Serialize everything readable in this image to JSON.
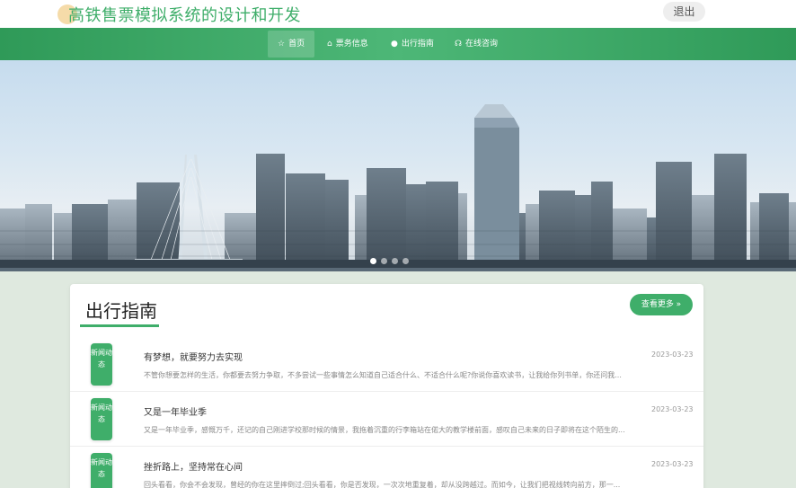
{
  "header": {
    "site_title": "高铁售票模拟系统的设计和开发",
    "logout_label": "退出"
  },
  "nav": {
    "items": [
      {
        "label": "首页",
        "icon": "star-icon",
        "glyph": "☆"
      },
      {
        "label": "票务信息",
        "icon": "bag-icon",
        "glyph": "⌂"
      },
      {
        "label": "出行指南",
        "icon": "circle-icon",
        "glyph": "●"
      },
      {
        "label": "在线咨询",
        "icon": "headset-icon",
        "glyph": "☊"
      }
    ],
    "active": "首页"
  },
  "banner": {
    "slide_count": 4,
    "active_slide": 1
  },
  "guide": {
    "title": "出行指南",
    "more_label": "查看更多 »",
    "items": [
      {
        "badge": "新闻动态",
        "title": "有梦想，就要努力去实现",
        "date": "2023-03-23",
        "summary": "不管你想要怎样的生活，你都要去努力争取，不多尝试一些事情怎么知道自己适合什么、不适合什么呢?你说你喜欢读书，让我给你列书单，你还问我..."
      },
      {
        "badge": "新闻动态",
        "title": "又是一年毕业季",
        "date": "2023-03-23",
        "summary": "又是一年毕业季，感慨万千，还记的自己刚进学校那时候的情景，我拖着沉重的行李箱站在偌大的教学楼前面，感叹自己未来的日子即将在这个陌生的..."
      },
      {
        "badge": "新闻动态",
        "title": "挫折路上，坚持常在心间",
        "date": "2023-03-23",
        "summary": "回头看看，你会不会发现，曾经的你在这里摔倒过;回头看看，你是否发现，一次次地重复着，却从没跨越过。而如今，让我们把视线转向前方，那一..."
      }
    ]
  }
}
